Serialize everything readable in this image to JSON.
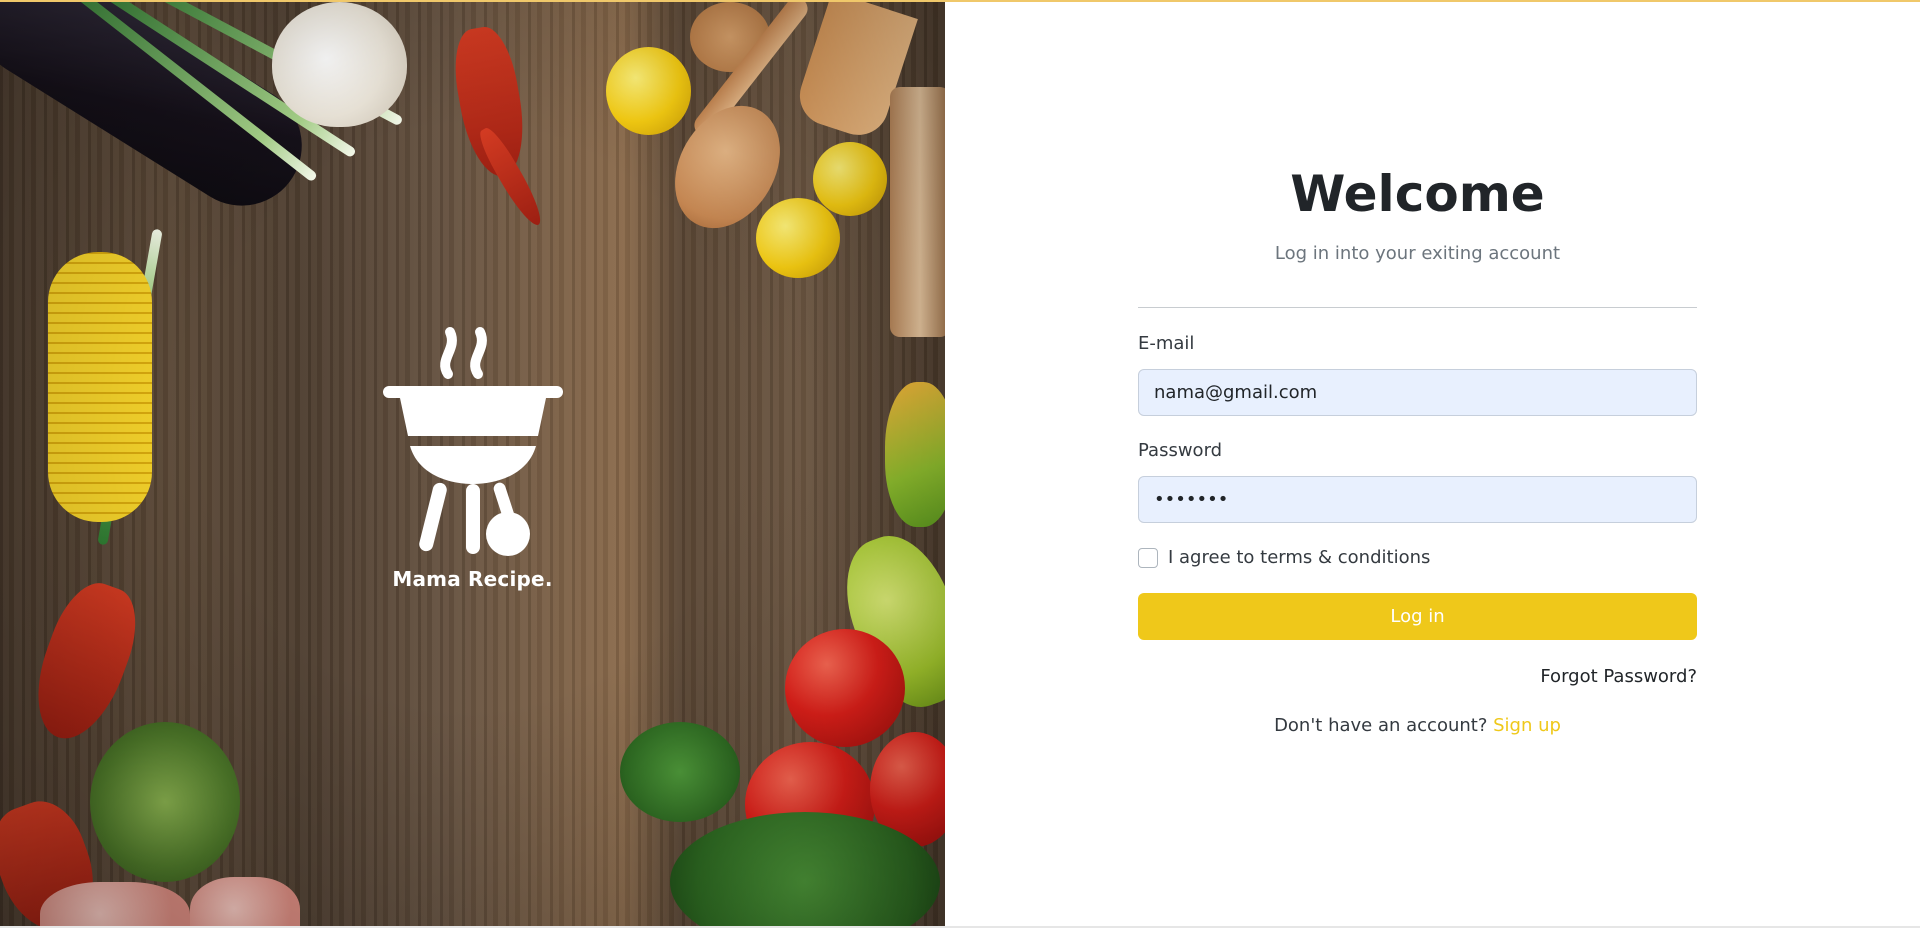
{
  "brand": {
    "name": "Mama Recipe.",
    "icon": "barbecue-grill-icon"
  },
  "login": {
    "title": "Welcome",
    "subtitle": "Log in into your exiting account",
    "email_label": "E-mail",
    "email_value": "nama@gmail.com",
    "password_label": "Password",
    "password_value": "•••••••",
    "terms_label": "I agree to terms & conditions",
    "terms_checked": false,
    "login_button": "Log in",
    "forgot_password": "Forgot Password?",
    "signup_prompt": "Don't have an account?",
    "signup_link": "Sign up"
  },
  "colors": {
    "accent": "#efc81a",
    "input_background": "#e8f0fe",
    "heading": "#212529",
    "muted_text": "#6c757d"
  }
}
